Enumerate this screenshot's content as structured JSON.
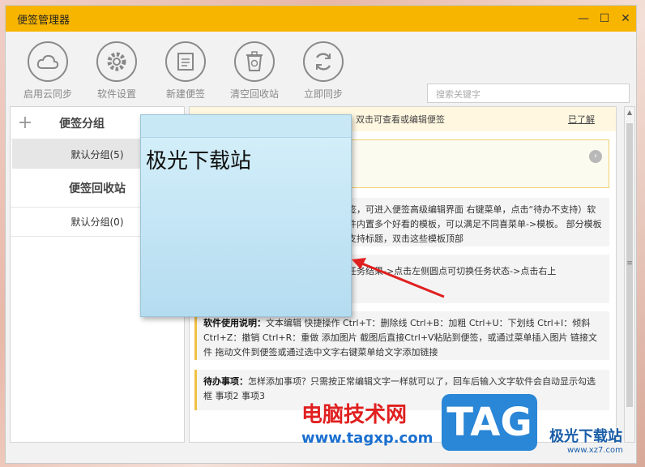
{
  "window": {
    "title": "便签管理器"
  },
  "controls": {
    "minimize": "—",
    "maximize": "☐",
    "close": "✕"
  },
  "toolbar": [
    {
      "label": "启用云同步",
      "icon": "cloud-icon"
    },
    {
      "label": "软件设置",
      "icon": "gear-icon"
    },
    {
      "label": "新建便签",
      "icon": "new-note-icon"
    },
    {
      "label": "清空回收站",
      "icon": "recycle-bin-icon"
    },
    {
      "label": "立即同步",
      "icon": "sync-icon"
    }
  ],
  "search": {
    "placeholder": "搜索关键字"
  },
  "sidebar": {
    "group_header": "便签分组",
    "add_symbol": "+",
    "default_group": "默认分组(5)",
    "recycle_header": "便签回收站",
    "recycle_group": "默认分组(0)"
  },
  "notice": {
    "text": "双击可查看或编辑便签",
    "link": "已了解"
  },
  "cards": {
    "c2": "签，可进入便签高级编辑界面 右键菜单，点击“待办不支持）软件内置多个好看的模板，可以满足不同喜菜单->模板。 部分模板支持标题，双击这些模板顶部",
    "c3": "任务结果->点击左侧圆点可切换任务状态->点击右上",
    "c4_title": "软件使用说明：",
    "c4": "文本编辑 快捷操作 Ctrl+T：删除线 Ctrl+B：加粗 Ctrl+U：下划线 Ctrl+I：倾斜 Ctrl+Z：撤销 Ctrl+R：重做 添加图片 截图后直接Ctrl+V粘贴到便签，或通过菜单插入图片 链接文件 拖动文件到便签或通过选中文字右键菜单给文字添加链接",
    "c5_title": "待办事项：",
    "c5": "怎样添加事项？只需按正常编辑文字一样就可以了，回车后输入文字软件会自动显示勾选框 事项2 事项3"
  },
  "sticky": {
    "text": "极光下载站"
  },
  "watermark": {
    "site_cn": "电脑技术网",
    "site_url": "www.tagxp.com",
    "logo": "TAG",
    "brand": "极光下载站",
    "brand_url": "www.xz7.com"
  }
}
